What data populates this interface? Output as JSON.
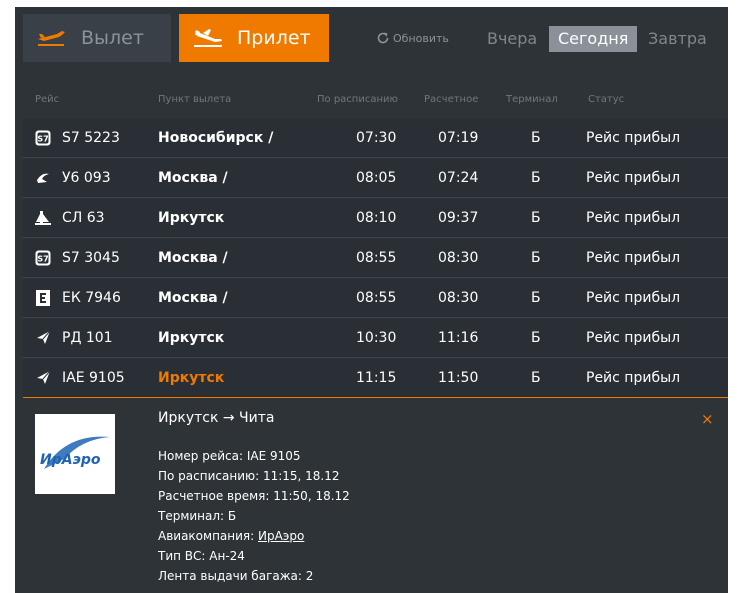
{
  "tabs": {
    "departure": "Вылет",
    "arrival": "Прилет"
  },
  "refresh_label": "Обновить",
  "days": {
    "yesterday": "Вчера",
    "today": "Сегодня",
    "tomorrow": "Завтра"
  },
  "columns": [
    "Рейс",
    "Пункт вылета",
    "По расписанию",
    "Расчетное",
    "Терминал",
    "Статус"
  ],
  "flights": [
    {
      "logo": "s7-icon",
      "flight": "S7 5223",
      "city": "Новосибирск /",
      "scheduled": "07:30",
      "estimated": "07:19",
      "terminal": "Б",
      "status": "Рейс прибыл"
    },
    {
      "logo": "ural-icon",
      "flight": "У6 093",
      "city": "Москва /",
      "scheduled": "08:05",
      "estimated": "07:24",
      "terminal": "Б",
      "status": "Рейс прибыл"
    },
    {
      "logo": "angara-icon",
      "flight": "СЛ 63",
      "city": "Иркутск",
      "scheduled": "08:10",
      "estimated": "09:37",
      "terminal": "Б",
      "status": "Рейс прибыл"
    },
    {
      "logo": "s7-icon",
      "flight": "S7 3045",
      "city": "Москва /",
      "scheduled": "08:55",
      "estimated": "08:30",
      "terminal": "Б",
      "status": "Рейс прибыл"
    },
    {
      "logo": "airline-e-icon",
      "flight": "ЕК 7946",
      "city": "Москва /",
      "scheduled": "08:55",
      "estimated": "08:30",
      "terminal": "Б",
      "status": "Рейс прибыл"
    },
    {
      "logo": "iraero-icon",
      "flight": "РД 101",
      "city": "Иркутск",
      "scheduled": "10:30",
      "estimated": "11:16",
      "terminal": "Б",
      "status": "Рейс прибыл"
    },
    {
      "logo": "iraero-icon",
      "flight": "IAE 9105",
      "city": "Иркутск",
      "scheduled": "11:15",
      "estimated": "11:50",
      "terminal": "Б",
      "status": "Рейс прибыл"
    }
  ],
  "detail": {
    "logo_text": "ИрАэро",
    "route": "Иркутск → Чита",
    "close": "×",
    "flight_number": "Номер рейса: IAE 9105",
    "scheduled": "По расписанию: 11:15, 18.12",
    "estimated": "Расчетное время: 11:50, 18.12",
    "terminal": "Терминал: Б",
    "airline_label": "Авиакомпания: ",
    "airline_link": "ИрАэро",
    "aircraft": "Тип ВС: Ан-24",
    "baggage": "Лента выдачи багажа: 2"
  },
  "colors": {
    "accent": "#f07a00",
    "panel": "#2e3338",
    "row": "#2a2f35",
    "active_day": "#8a9199"
  }
}
